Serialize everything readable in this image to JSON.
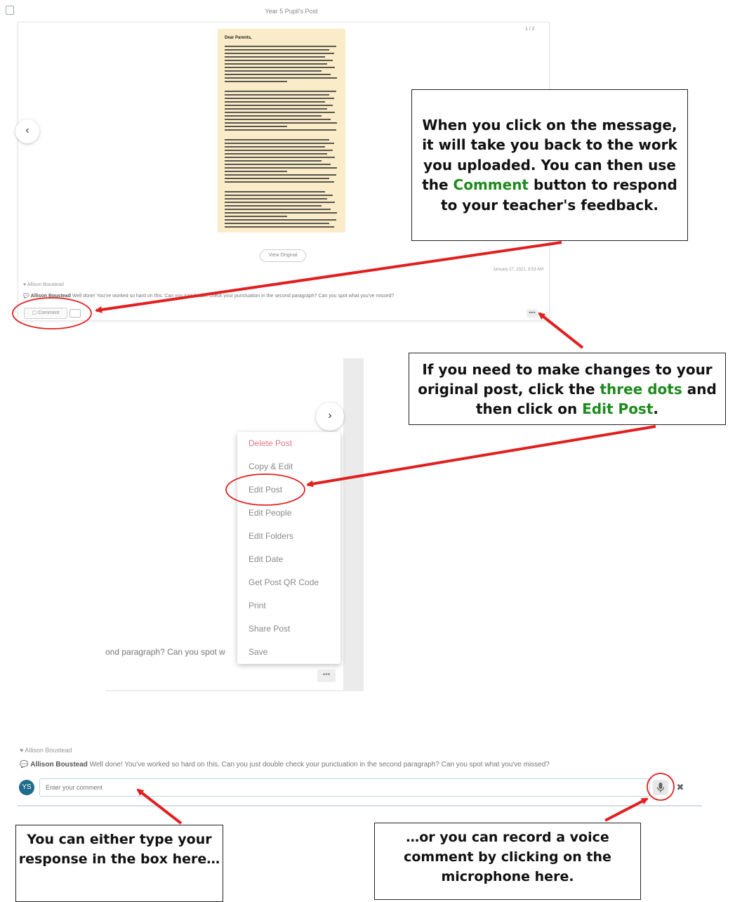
{
  "top_panel": {
    "title": "Year 5 Pupil's Post",
    "page_count": "1 / 2",
    "document_heading": "Dear Parents,",
    "view_original": "View Original",
    "timestamp": "January 27, 2021, 9:53 AM",
    "like_name": "Allison Boustead",
    "comment_author": "Allison Boustead",
    "comment_text": "Well done! You've worked so hard on this. Can you just double check your punctuation in the second paragraph? Can you spot what you've missed?",
    "comment_button": "Comment",
    "dots": "•••"
  },
  "callouts": {
    "comment": {
      "before": "When you click on the message, it will take you back to the work you uploaded. You can then use the ",
      "highlight": "Comment",
      "after": " button to respond to your teacher's feedback."
    },
    "edit": {
      "part1": "If you need to make changes to your original post, click the ",
      "highlight1": "three dots",
      "part2": " and then click on ",
      "highlight2": "Edit Post",
      "part3": "."
    },
    "type": "You can either type your response in the box here…",
    "voice": "…or you can record a voice comment by clicking on the microphone here."
  },
  "menu_panel": {
    "partial_comment": "ond paragraph? Can you spot w",
    "dots": "•••",
    "items": [
      {
        "label": "Delete Post"
      },
      {
        "label": "Copy & Edit"
      },
      {
        "label": "Edit Post"
      },
      {
        "label": "Edit People"
      },
      {
        "label": "Edit Folders"
      },
      {
        "label": "Edit Date"
      },
      {
        "label": "Get Post QR Code"
      },
      {
        "label": "Print"
      },
      {
        "label": "Share Post"
      },
      {
        "label": "Save"
      }
    ]
  },
  "bottom_panel": {
    "like_name": "Allison Boustead",
    "comment_author": "Allison Boustead",
    "comment_text": "Well done! You've worked so hard on this. Can you just double check your punctuation in the second paragraph? Can you spot what you've missed?",
    "avatar_initials": "YS",
    "input_placeholder": "Enter your comment",
    "close": "✖"
  },
  "colors": {
    "annotation_red": "#e02020",
    "highlight_green": "#1d8a1d",
    "document_paper": "#faecc9",
    "avatar": "#1f6c8a"
  },
  "icons": [
    "heart-icon",
    "speech-bubble-icon",
    "chevron-left-icon",
    "chevron-right-icon",
    "microphone-icon",
    "close-icon",
    "attachment-icon"
  ]
}
